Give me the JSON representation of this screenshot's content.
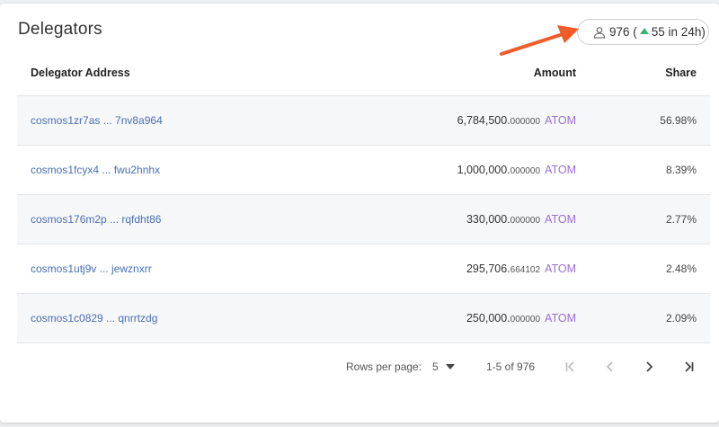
{
  "card": {
    "title": "Delegators",
    "count": {
      "total": "976 (",
      "delta": "55 in 24h)",
      "icons": {
        "user": "user-icon",
        "up": "triangle-up-icon"
      },
      "delta_color": "#3cb371"
    }
  },
  "table": {
    "headers": {
      "address": "Delegator Address",
      "amount": "Amount",
      "share": "Share"
    },
    "rows": [
      {
        "address": "cosmos1zr7as ... 7nv8a964",
        "amount_int": "6,784,500.",
        "amount_dec": "000000",
        "denom": "ATOM",
        "share": "56.98%"
      },
      {
        "address": "cosmos1fcyx4 ... fwu2hnhx",
        "amount_int": "1,000,000.",
        "amount_dec": "000000",
        "denom": "ATOM",
        "share": "8.39%"
      },
      {
        "address": "cosmos176m2p ... rqfdht86",
        "amount_int": "330,000.",
        "amount_dec": "000000",
        "denom": "ATOM",
        "share": "2.77%"
      },
      {
        "address": "cosmos1utj9v ... jewznxrr",
        "amount_int": "295,706.",
        "amount_dec": "664102",
        "denom": "ATOM",
        "share": "2.48%"
      },
      {
        "address": "cosmos1c0829 ... qnrrtzdg",
        "amount_int": "250,000.",
        "amount_dec": "000000",
        "denom": "ATOM",
        "share": "2.09%"
      }
    ]
  },
  "pagination": {
    "rows_per_page_label": "Rows per page:",
    "rows_per_page_value": "5",
    "range": "1-5 of 976",
    "icons": {
      "first": "first-page-icon",
      "prev": "chevron-left-icon",
      "next": "chevron-right-icon",
      "last": "last-page-icon"
    }
  },
  "colors": {
    "link": "#4a6fb0",
    "denom": "#9b6fd6",
    "annotation_arrow": "#f15a29"
  }
}
